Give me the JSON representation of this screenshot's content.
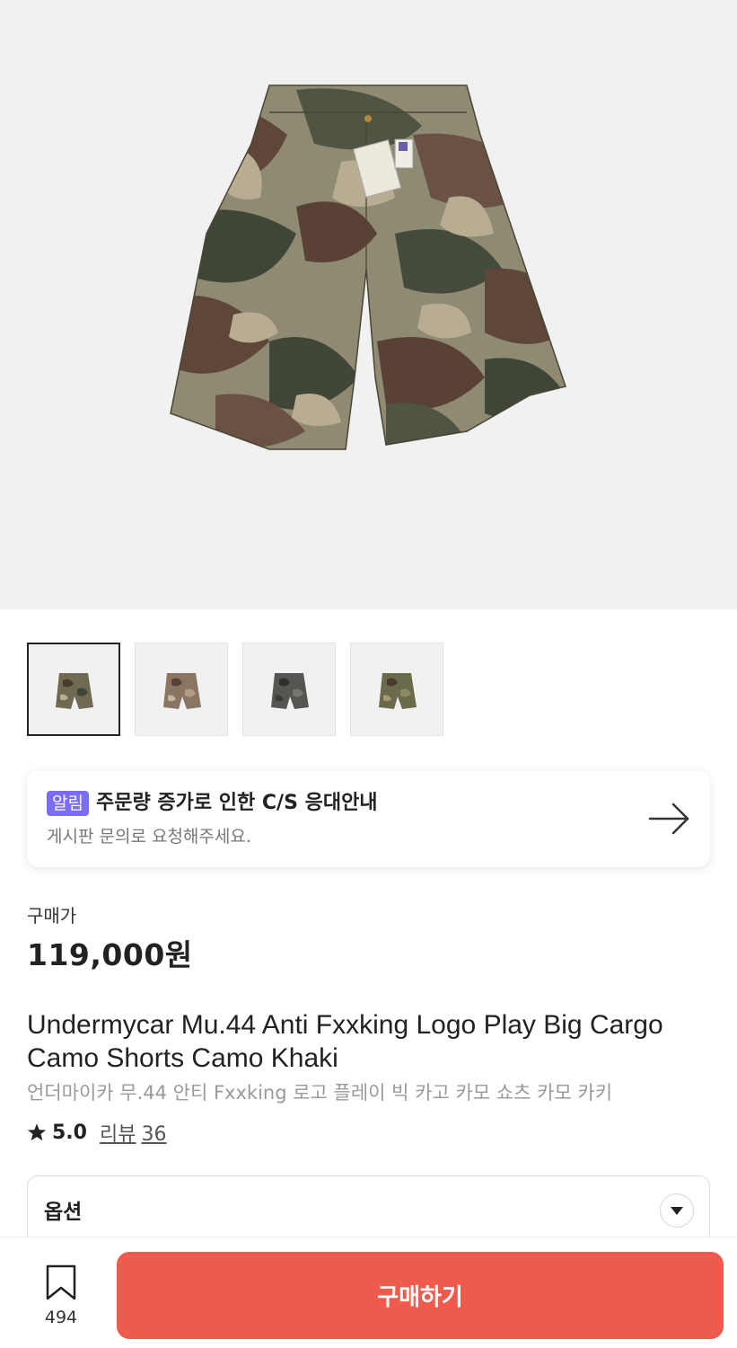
{
  "thumbnails": [
    {
      "tone": "#6f6a52"
    },
    {
      "tone": "#8a7462"
    },
    {
      "tone": "#555552"
    },
    {
      "tone": "#6a6a4c"
    }
  ],
  "notice": {
    "badge": "알림",
    "title": "주문량 증가로 인한 C/S 응대안내",
    "subtitle": "게시판 문의로 요청해주세요.",
    "arrow_icon": "arrow-right-icon"
  },
  "price": {
    "label": "구매가",
    "value": "119,000원"
  },
  "product": {
    "title_en": "Undermycar Mu.44 Anti Fxxking Logo Play Big Cargo Camo Shorts Camo Khaki",
    "title_ko": "언더마이카 무.44 안티 Fxxking 로고 플레이 빅 카고 카모 쇼츠 카모 카키"
  },
  "rating": {
    "score": "5.0",
    "review_label": "리뷰",
    "review_count": "36"
  },
  "option": {
    "label": "옵션"
  },
  "bottom_bar": {
    "bookmark_count": "494",
    "buy_label": "구매하기"
  },
  "colors": {
    "accent": "#ee5a4c",
    "badge": "#7b6cf6"
  }
}
